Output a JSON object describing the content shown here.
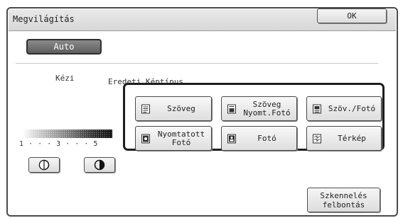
{
  "dialog": {
    "title": "Megvilágítás",
    "ok_label": "OK"
  },
  "mode": {
    "auto_label": "Auto",
    "manual_label": "Kézi",
    "selected": "Auto"
  },
  "original_type": {
    "label": "Eredeti Képtípus",
    "buttons": [
      {
        "label": "Szöveg",
        "icon": "text-doc-icon"
      },
      {
        "label": "Szöveg\nNyomt.Fotó",
        "icon": "text-printed-photo-icon"
      },
      {
        "label": "Szöv./Fotó",
        "icon": "text-photo-icon"
      },
      {
        "label": "Nyomtatott\nFotó",
        "icon": "printed-photo-icon"
      },
      {
        "label": "Fotó",
        "icon": "photo-icon"
      },
      {
        "label": "Térkép",
        "icon": "map-icon"
      }
    ]
  },
  "exposure": {
    "scale_text": "1 · · · 3 · · · 5",
    "lighter_icon": "lighter-icon",
    "darker_icon": "darker-icon"
  },
  "scan_resolution": {
    "label": "Szkennelés\nfelbontás"
  }
}
